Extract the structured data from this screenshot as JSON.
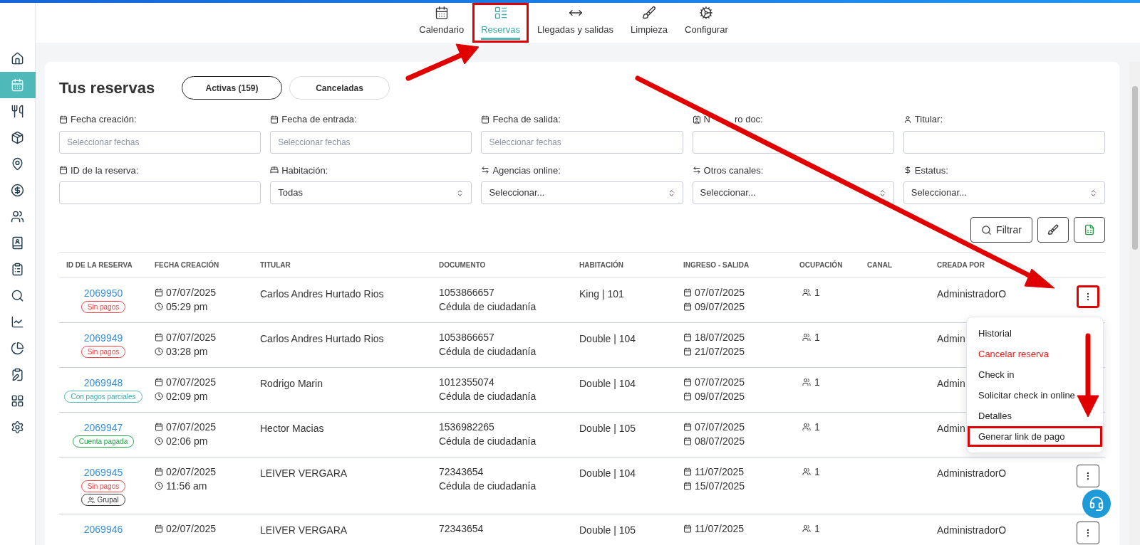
{
  "sidebar": {
    "items": [
      {
        "selected": false
      },
      {
        "selected": true
      },
      {
        "selected": false
      },
      {
        "selected": false
      },
      {
        "selected": false
      },
      {
        "selected": false
      },
      {
        "selected": false
      },
      {
        "selected": false
      },
      {
        "selected": false
      },
      {
        "selected": false
      },
      {
        "selected": false
      },
      {
        "selected": false
      },
      {
        "selected": false
      },
      {
        "selected": false
      },
      {
        "selected": false
      }
    ]
  },
  "nav_tabs": [
    {
      "label": "Calendario",
      "selected": false,
      "highlighted": false
    },
    {
      "label": "Reservas",
      "selected": true,
      "highlighted": true
    },
    {
      "label": "Llegadas y salidas",
      "selected": false,
      "highlighted": false
    },
    {
      "label": "Limpieza",
      "selected": false,
      "highlighted": false
    },
    {
      "label": "Configurar",
      "selected": false,
      "highlighted": false
    }
  ],
  "title": "Tus reservas",
  "status_tabs": [
    {
      "label": "Activas (159)",
      "selected": true
    },
    {
      "label": "Canceladas",
      "selected": false
    }
  ],
  "filters": [
    {
      "label": "Fecha creación:",
      "kind": "date",
      "placeholder": "Seleccionar fechas"
    },
    {
      "label": "Fecha de entrada:",
      "kind": "date",
      "placeholder": "Seleccionar fechas"
    },
    {
      "label": "Fecha de salida:",
      "kind": "date",
      "placeholder": "Seleccionar fechas"
    },
    {
      "label": "N",
      "label_after": "ro doc:",
      "kind": "doc"
    },
    {
      "label": "Titular:",
      "kind": "person"
    },
    {
      "label": "ID de la reserva:",
      "kind": "id"
    },
    {
      "label": "Habitación:",
      "kind": "room",
      "value": "Todas"
    },
    {
      "label": "Agencias online:",
      "kind": "channel",
      "value": "Seleccionar..."
    },
    {
      "label": "Otros canales:",
      "kind": "channel",
      "value": "Seleccionar..."
    },
    {
      "label": "Estatus:",
      "kind": "status",
      "value": "Seleccionar..."
    }
  ],
  "filter_button": "Filtrar",
  "table": {
    "columns": [
      "ID DE LA RESERVA",
      "FECHA CREACIÓN",
      "TITULAR",
      "DOCUMENTO",
      "HABITACIÓN",
      "INGRESO - SALIDA",
      "OCUPACIÓN",
      "CANAL",
      "CREADA POR"
    ],
    "rows": [
      {
        "id": "2069950",
        "badges": [
          {
            "label": "Sin pagos",
            "kind": "unpaid"
          }
        ],
        "date": "07/07/2025",
        "time": "05:29 pm",
        "holder": "Carlos Andres Hurtado Rios",
        "doc": "1053866657",
        "doc_type": "Cédula de ciudadanía",
        "room": "King | 101",
        "check_in": "07/07/2025",
        "check_out": "09/07/2025",
        "occupancy": "1",
        "created_by": "AdministradorO",
        "actions": {
          "highlighted": true
        }
      },
      {
        "id": "2069949",
        "badges": [
          {
            "label": "Sin pagos",
            "kind": "unpaid"
          }
        ],
        "date": "07/07/2025",
        "time": "03:28 pm",
        "holder": "Carlos Andres Hurtado Rios",
        "doc": "1053866657",
        "doc_type": "Cédula de ciudadanía",
        "room": "Double | 104",
        "check_in": "18/07/2025",
        "check_out": "21/07/2025",
        "occupancy": "1",
        "created_by": "Admin"
      },
      {
        "id": "2069948",
        "badges": [
          {
            "label": "Con pagos parciales",
            "kind": "partial"
          }
        ],
        "date": "07/07/2025",
        "time": "02:09 pm",
        "holder": "Rodrigo Marin",
        "doc": "1012355074",
        "doc_type": "Cédula de ciudadanía",
        "room": "Double | 104",
        "check_in": "07/07/2025",
        "check_out": "09/07/2025",
        "occupancy": "1",
        "created_by": "Admin"
      },
      {
        "id": "2069947",
        "badges": [
          {
            "label": "Cuenta pagada",
            "kind": "paid"
          }
        ],
        "date": "07/07/2025",
        "time": "02:06 pm",
        "holder": "Hector Macias",
        "doc": "1536982265",
        "doc_type": "Cédula de ciudadanía",
        "room": "Double | 105",
        "check_in": "07/07/2025",
        "check_out": "08/07/2025",
        "occupancy": "1",
        "created_by": "Admin"
      },
      {
        "id": "2069945",
        "badges": [
          {
            "label": "Sin pagos",
            "kind": "unpaid"
          },
          {
            "label": "Grupal",
            "kind": "group"
          }
        ],
        "date": "02/07/2025",
        "time": "11:56 am",
        "holder": "LEIVER VERGARA",
        "doc": "72343654",
        "doc_type": "Cédula de ciudadanía",
        "room": "Double | 104",
        "check_in": "11/07/2025",
        "check_out": "15/07/2025",
        "occupancy": "1",
        "created_by": "AdministradorO",
        "actions": {
          "highlighted": false
        }
      },
      {
        "id": "2069946",
        "badges": [],
        "date": "02/07/2025",
        "holder": "LEIVER VERGARA",
        "doc": "72343654",
        "room": "Double | 105",
        "check_in": "11/07/2025",
        "occupancy": "1",
        "created_by": "AdministradorO",
        "actions": {
          "highlighted": false
        }
      }
    ]
  },
  "menu": {
    "items": [
      {
        "label": "Historial",
        "kind": "normal",
        "highlighted": false
      },
      {
        "label": "Cancelar reserva",
        "kind": "danger",
        "highlighted": false
      },
      {
        "label": "Check in",
        "kind": "normal",
        "highlighted": false
      },
      {
        "label": "Solicitar check in online",
        "kind": "normal",
        "highlighted": false
      },
      {
        "label": "Detalles",
        "kind": "normal",
        "highlighted": false
      },
      {
        "label": "Generar link de pago",
        "kind": "normal",
        "highlighted": true
      }
    ]
  }
}
